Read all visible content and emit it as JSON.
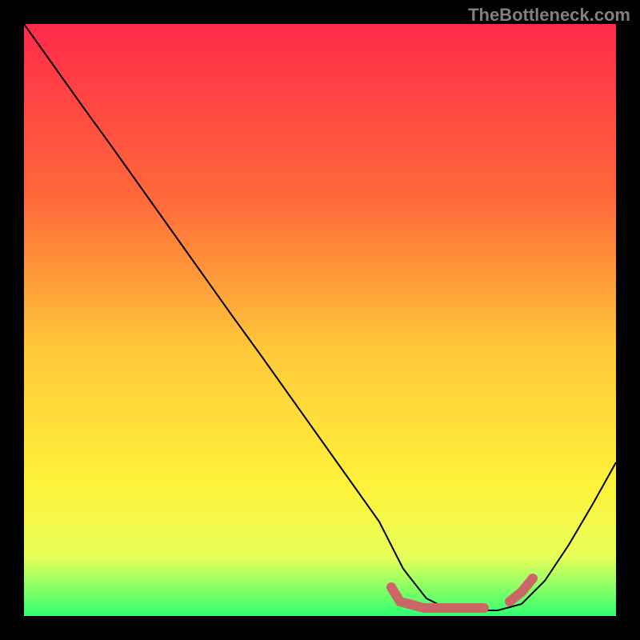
{
  "watermark": "TheBottleneck.com",
  "colors": {
    "background": "#000000",
    "gradient_top": "#ff2a4a",
    "gradient_mid1": "#ff8c3a",
    "gradient_mid2": "#ffe03a",
    "gradient_mid3": "#f5ff5a",
    "gradient_bottom": "#30ff70",
    "curve": "#000000",
    "marker": "#cc6666"
  },
  "chart_data": {
    "type": "line",
    "title": "",
    "xlabel": "",
    "ylabel": "",
    "xlim": [
      0,
      100
    ],
    "ylim": [
      0,
      100
    ],
    "series": [
      {
        "name": "bottleneck-curve",
        "x": [
          0,
          5,
          10,
          15,
          20,
          25,
          30,
          35,
          40,
          45,
          50,
          55,
          60,
          64,
          68,
          72,
          76,
          80,
          84,
          88,
          92,
          96,
          100
        ],
        "y": [
          100,
          93,
          86,
          79,
          72,
          65,
          58,
          51,
          44,
          37,
          30,
          23,
          16,
          8,
          3,
          1,
          1,
          1,
          2,
          6,
          12,
          19,
          26
        ]
      }
    ],
    "annotations": [
      {
        "name": "flat-region-marker",
        "x_start": 62,
        "x_end": 78,
        "y": 1
      },
      {
        "name": "right-rise-marker",
        "x_start": 82,
        "x_end": 86,
        "y": 4
      }
    ],
    "gradient_stops": [
      {
        "offset": 0.0,
        "color": "#ff2a4a"
      },
      {
        "offset": 0.3,
        "color": "#ff6a3a"
      },
      {
        "offset": 0.55,
        "color": "#ffc83a"
      },
      {
        "offset": 0.78,
        "color": "#fff23a"
      },
      {
        "offset": 0.9,
        "color": "#e8ff5a"
      },
      {
        "offset": 1.0,
        "color": "#30ff70"
      }
    ]
  }
}
